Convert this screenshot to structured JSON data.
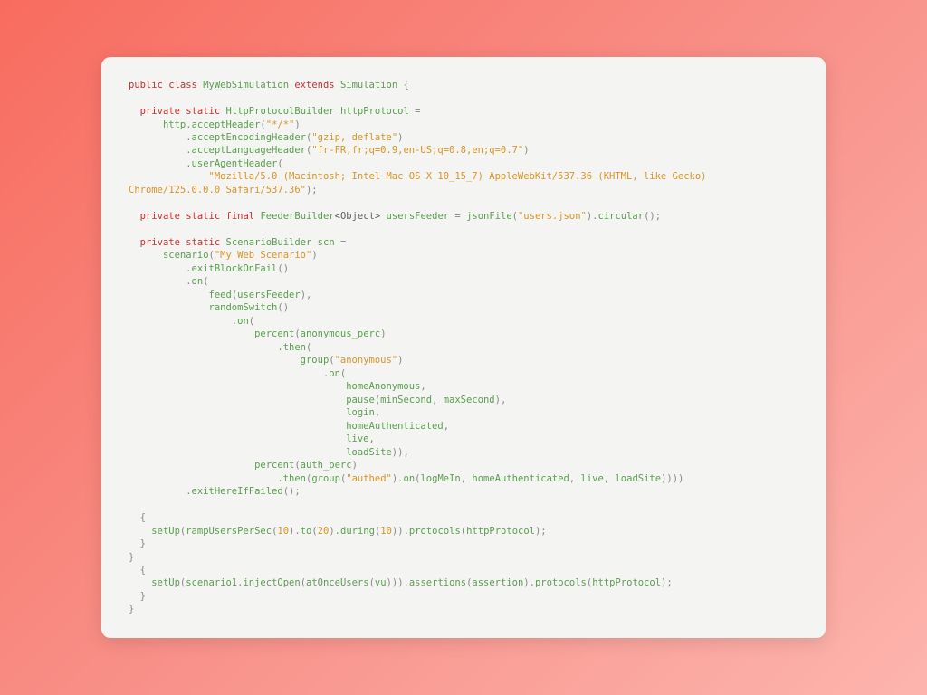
{
  "code": {
    "l1_public": "public",
    "l1_class": "class",
    "l1_name": "MyWebSimulation",
    "l1_extends": "extends",
    "l1_sim": "Simulation",
    "l1_brace": "{",
    "l2_private": "private",
    "l2_static": "static",
    "l2_type": "HttpProtocolBuilder",
    "l2_var": "httpProtocol",
    "l2_eq": "=",
    "l3_http": "http",
    "l3_acceptHeader": "acceptHeader",
    "l3_arg": "\"*/*\"",
    "l4_method": "acceptEncodingHeader",
    "l4_arg": "\"gzip, deflate\"",
    "l5_method": "acceptLanguageHeader",
    "l5_arg": "\"fr-FR,fr;q=0.9,en-US;q=0.8,en;q=0.7\"",
    "l6_method": "userAgentHeader",
    "l7_arg": "\"Mozilla/5.0 (Macintosh; Intel Mac OS X 10_15_7) AppleWebKit/537.36 (KHTML, like Gecko) Chrome/125.0.0.0 Safari/537.36\"",
    "l8_private": "private",
    "l8_static": "static",
    "l8_final": "final",
    "l8_type": "FeederBuilder",
    "l8_generic": "<Object>",
    "l8_var": "usersFeeder",
    "l8_eq": "=",
    "l8_json": "jsonFile",
    "l8_arg": "\"users.json\"",
    "l8_circ": "circular",
    "l9_private": "private",
    "l9_static": "static",
    "l9_type": "ScenarioBuilder",
    "l9_var": "scn",
    "l9_eq": "=",
    "l10_scenario": "scenario",
    "l10_arg": "\"My Web Scenario\"",
    "l11_method": "exitBlockOnFail",
    "l12_on": "on",
    "l13_feed": "feed",
    "l13_arg": "usersFeeder",
    "l14_rand": "randomSwitch",
    "l15_on": "on",
    "l16_percent": "percent",
    "l16_arg": "anonymous_perc",
    "l17_then": "then",
    "l18_group": "group",
    "l18_arg": "\"anonymous\"",
    "l19_on": "on",
    "l20_home": "homeAnonymous",
    "l21_pause": "pause",
    "l21_min": "minSecond",
    "l21_max": "maxSecond",
    "l22_login": "login",
    "l23_homeA": "homeAuthenticated",
    "l24_live": "live",
    "l25_load": "loadSite",
    "l26_percent": "percent",
    "l26_arg": "auth_perc",
    "l27_then": "then",
    "l27_group": "group",
    "l27_arg": "\"authed\"",
    "l27_on": "on",
    "l27_log": "logMeIn",
    "l27_homeA": "homeAuthenticated",
    "l27_live": "live",
    "l27_load": "loadSite",
    "l28_exit": "exitHereIfFailed",
    "l30_setUp": "setUp",
    "l30_ramp": "rampUsersPerSec",
    "l30_10a": "10",
    "l30_to": "to",
    "l30_20": "20",
    "l30_during": "during",
    "l30_10b": "10",
    "l30_proto": "protocols",
    "l30_hp": "httpProtocol",
    "l33_setUp": "setUp",
    "l33_scn": "scenario1",
    "l33_inj": "injectOpen",
    "l33_at": "atOnceUsers",
    "l33_vu": "vu",
    "l33_assert": "assertions",
    "l33_a": "assertion",
    "l33_proto": "protocols",
    "l33_hp": "httpProtocol"
  }
}
